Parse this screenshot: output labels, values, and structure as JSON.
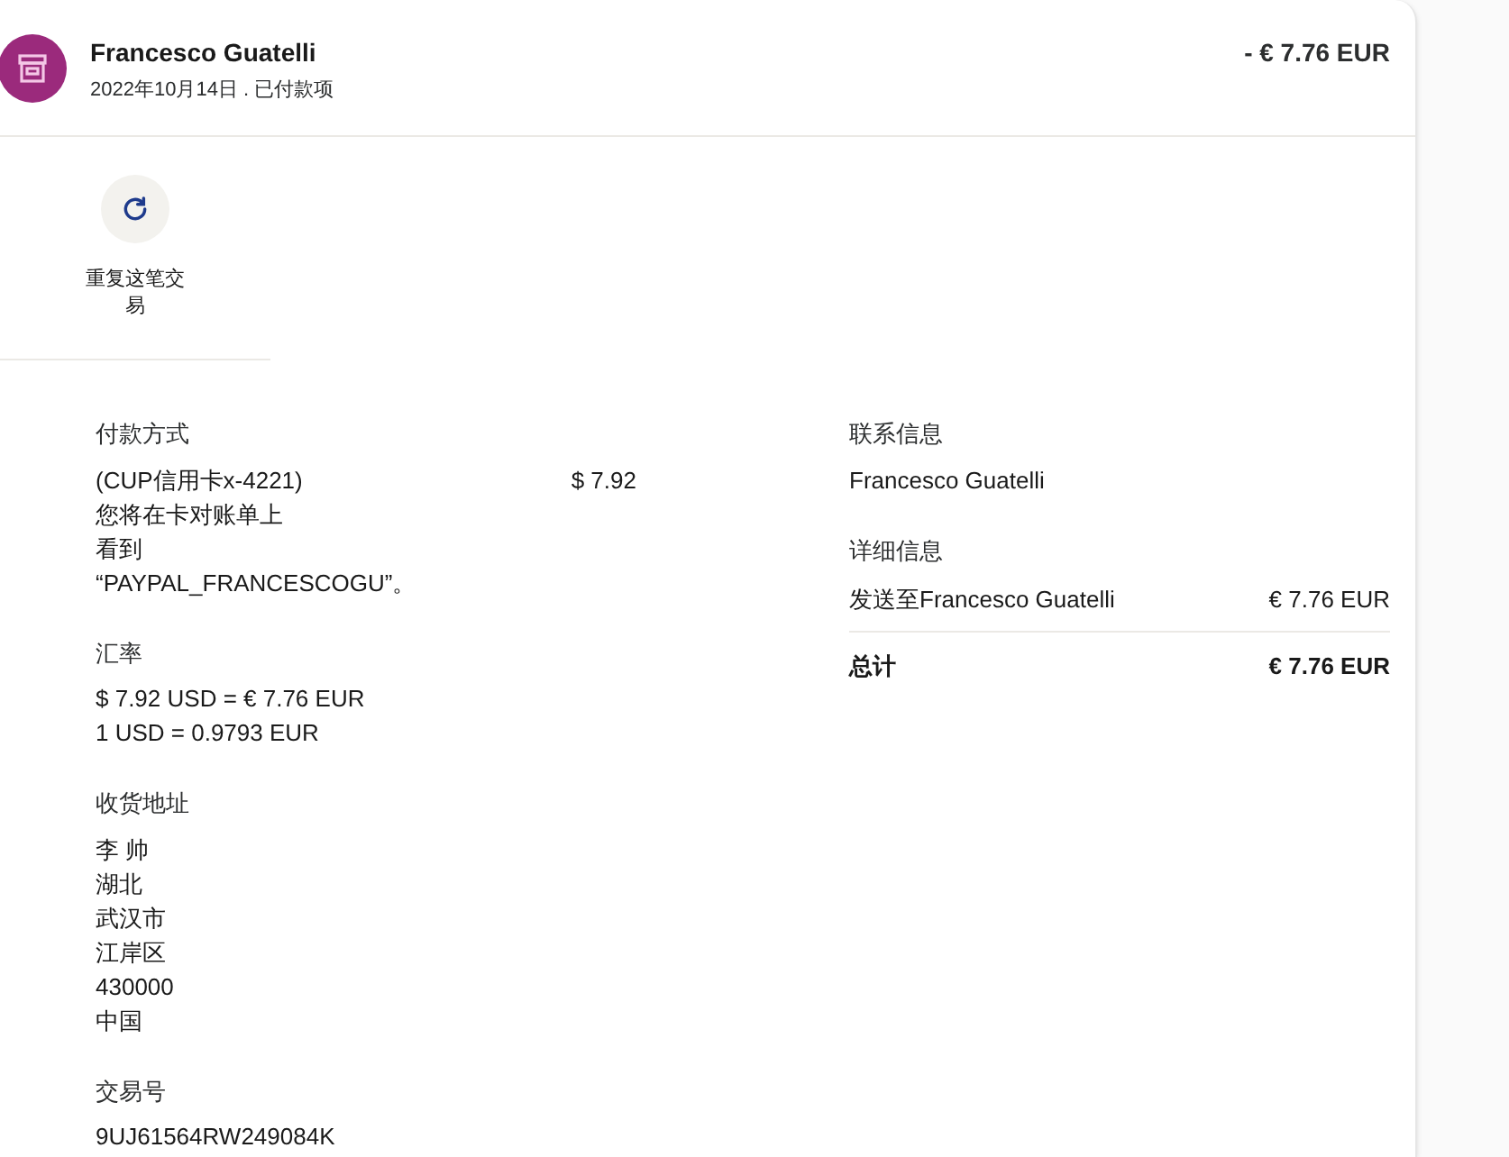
{
  "header": {
    "name": "Francesco Guatelli",
    "subtitle": "2022年10月14日 . 已付款项",
    "amount": "- € 7.76 EUR"
  },
  "action": {
    "label": "重复这笔交易"
  },
  "payment": {
    "heading": "付款方式",
    "card": "(CUP信用卡x-4221)",
    "card_amount": "$ 7.92",
    "lines": [
      "您将在卡对账单上",
      "看到",
      "“PAYPAL_FRANCESCOGU”。"
    ]
  },
  "exchange": {
    "heading": "汇率",
    "lines": [
      "$ 7.92 USD = € 7.76 EUR",
      "1 USD = 0.9793 EUR"
    ]
  },
  "shipping": {
    "heading": "收货地址",
    "lines": [
      "李 帅",
      "湖北",
      "武汉市",
      "江岸区",
      "430000",
      "中国"
    ]
  },
  "transaction": {
    "heading": "交易号",
    "id": "9UJ61564RW249084K"
  },
  "contact": {
    "heading": "联系信息",
    "name": "Francesco Guatelli"
  },
  "details": {
    "heading": "详细信息",
    "rows": [
      {
        "label": "发送至Francesco Guatelli",
        "amount": "€ 7.76 EUR"
      }
    ]
  },
  "total": {
    "label": "总计",
    "amount": "€ 7.76 EUR"
  }
}
